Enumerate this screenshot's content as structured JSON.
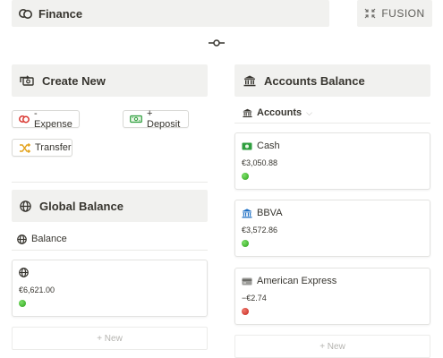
{
  "finance_bar": {
    "title": "Finance",
    "icon": "coins-icon"
  },
  "fusion_button": {
    "label": "FUSION",
    "icon": "collapse-arrows-icon"
  },
  "divider": {
    "icon": "commit-node-icon"
  },
  "create_new": {
    "title": "Create New",
    "icon": "refresh-money-icon",
    "buttons": [
      {
        "label": "- Expense",
        "icon": "coins-red-icon"
      },
      {
        "label": "+ Deposit",
        "icon": "banknote-green-icon"
      },
      {
        "label": "Transfer",
        "icon": "shuffle-arrows-icon"
      }
    ]
  },
  "global_balance": {
    "title": "Global Balance",
    "icon": "globe-icon",
    "view_label": "Balance",
    "card": {
      "icon": "globe-icon",
      "amount": "€6,621.00",
      "status_color": "#3dbb2b"
    },
    "new_label": "+ New"
  },
  "accounts_balance": {
    "title": "Accounts Balance",
    "icon": "bank-icon",
    "view_label": "Accounts",
    "cards": [
      {
        "name": "Cash",
        "icon": "cash-icon",
        "amount": "€3,050.88",
        "status_color": "#3dbb2b"
      },
      {
        "name": "BBVA",
        "icon": "bank-icon",
        "amount": "€3,572.86",
        "status_color": "#3dbb2b"
      },
      {
        "name": "American Express",
        "icon": "credit-card-icon",
        "amount": "−€2.74",
        "status_color": "#d9362f"
      }
    ],
    "new_label": "+ New"
  },
  "colors": {
    "header_bg": "#f1f1ef",
    "positive": "#3dbb2b",
    "negative": "#d9362f"
  }
}
